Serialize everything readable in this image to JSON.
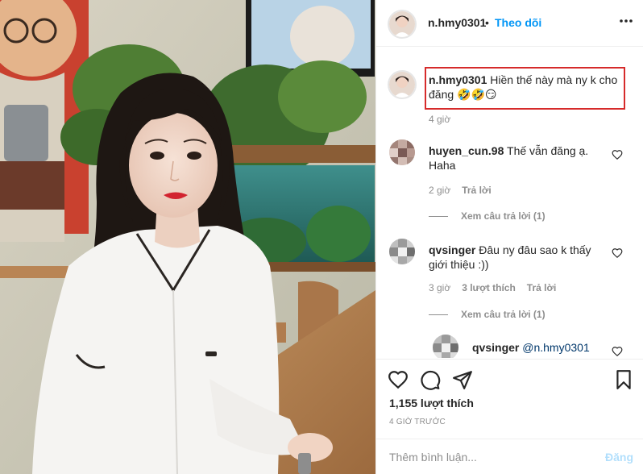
{
  "post": {
    "username": "n.hmy0301",
    "separator": "•",
    "follow_label": "Theo dõi",
    "more_icon": "more-horizontal-icon",
    "caption": {
      "username": "n.hmy0301",
      "text": "Hiền thế này mà ny k cho đăng 🤣🤣😏",
      "time": "4 giờ"
    },
    "comments": [
      {
        "username": "huyen_cun.98",
        "text": "Thế vẫn đăng ạ. Haha",
        "time": "2 giờ",
        "reply_label": "Trả lời",
        "view_replies": "Xem câu trả lời (1)"
      },
      {
        "username": "qvsinger",
        "text": "Đâu ny đâu sao k thấy giới thiệu :))",
        "time": "3 giờ",
        "likes": "3 lượt thích",
        "reply_label": "Trả lời",
        "view_replies": "Xem câu trả lời (1)",
        "reply": {
          "username": "qvsinger",
          "mention": "@n.hmy0301"
        }
      }
    ],
    "actions": {
      "like_icon": "heart-icon",
      "comment_icon": "comment-icon",
      "share_icon": "send-icon",
      "save_icon": "bookmark-icon"
    },
    "likes_count": "1,155 lượt thích",
    "posted_ago": "4 GIỜ TRƯỚC",
    "comment_input": {
      "placeholder": "Thêm bình luận...",
      "post_label": "Đăng"
    }
  },
  "colors": {
    "link_blue": "#0095f6",
    "highlight_red": "#d62b2b",
    "muted": "#8e8e8e",
    "post_disabled": "#b2dffc"
  }
}
